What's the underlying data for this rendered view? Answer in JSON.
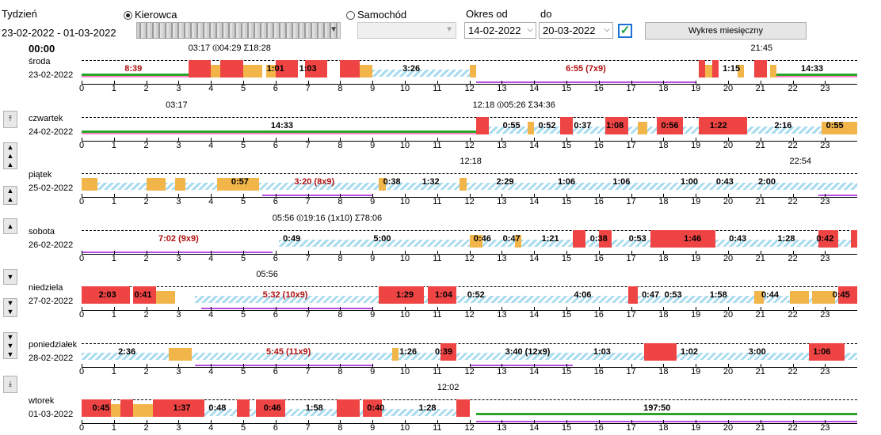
{
  "header": {
    "week_label": "Tydzień",
    "week_range": "23-02-2022 - 01-03-2022",
    "driver_radio": "Kierowca",
    "vehicle_radio": "Samochód",
    "period_from_label": "Okres od",
    "period_to_label": "do",
    "date_from": "14-02-2022",
    "date_to": "20-03-2022",
    "monthly_button": "Wykres miesięczny",
    "start_time": "00:00"
  },
  "colors": {
    "drive": "#ee4444",
    "work": "#f2b54a",
    "rest_hatch": "#a9dcef",
    "green": "#2aa52a",
    "pink": "#ff88cc",
    "purple": "#b44fe0",
    "red_line": "#e33"
  },
  "hours": [
    "0",
    "1",
    "2",
    "3",
    "4",
    "5",
    "6",
    "7",
    "8",
    "9",
    "10",
    "11",
    "12",
    "13",
    "14",
    "15",
    "16",
    "17",
    "18",
    "19",
    "20",
    "21",
    "22",
    "23"
  ],
  "days": [
    {
      "name": "środa",
      "date": "23-02-2022",
      "stats": [
        {
          "text": "03:17 ⏼04:29 Σ18:28",
          "h": 3.3
        },
        {
          "text": "21:45",
          "h": 20.7
        }
      ],
      "labels": [
        {
          "t": "8:39",
          "h": 1.6,
          "red": true
        },
        {
          "t": "1:01",
          "h": 6.0
        },
        {
          "t": "1:03",
          "h": 7.0
        },
        {
          "t": "3:26",
          "h": 10.2
        },
        {
          "t": "6:55 (7x9)",
          "h": 15.6,
          "red": true
        },
        {
          "t": "1:15",
          "h": 20.1
        },
        {
          "t": "14:33",
          "h": 22.6
        }
      ],
      "drive": [
        [
          3.3,
          4.0
        ],
        [
          4.3,
          5.0
        ],
        [
          6.0,
          6.7
        ],
        [
          6.9,
          7.6
        ],
        [
          8.0,
          8.6
        ],
        [
          19.1,
          19.3
        ],
        [
          19.5,
          19.7
        ],
        [
          20.8,
          21.2
        ]
      ],
      "work": [
        [
          4.0,
          4.3
        ],
        [
          5.0,
          5.6
        ],
        [
          5.7,
          6.0
        ],
        [
          8.6,
          9.0
        ],
        [
          12.0,
          12.2
        ],
        [
          19.3,
          19.5
        ],
        [
          20.3,
          20.5
        ],
        [
          21.3,
          21.5
        ]
      ],
      "rest": [
        [
          9.0,
          12.0
        ]
      ],
      "green": [
        [
          0,
          3.3
        ],
        [
          21.5,
          24
        ]
      ],
      "pink": [
        [
          0,
          3.3
        ],
        [
          21.5,
          24
        ]
      ],
      "purple": [
        [
          12.2,
          19.0
        ]
      ]
    },
    {
      "name": "czwartek",
      "date": "24-02-2022",
      "stats": [
        {
          "text": "03:17",
          "h": 2.6
        },
        {
          "text": "12:18 ⏼05:26 Σ34:36",
          "h": 12.1
        }
      ],
      "labels": [
        {
          "t": "14:33",
          "h": 6.2
        },
        {
          "t": "0:55",
          "h": 13.3
        },
        {
          "t": "0:52",
          "h": 14.4
        },
        {
          "t": "0:37",
          "h": 15.5
        },
        {
          "t": "1:08",
          "h": 16.5
        },
        {
          "t": "0:56",
          "h": 18.2
        },
        {
          "t": "1:22",
          "h": 19.7
        },
        {
          "t": "2:16",
          "h": 21.7
        },
        {
          "t": "0:55",
          "h": 23.3
        }
      ],
      "drive": [
        [
          12.2,
          12.6
        ],
        [
          14.8,
          15.2
        ],
        [
          16.2,
          16.9
        ],
        [
          17.8,
          18.6
        ],
        [
          19.1,
          20.6
        ]
      ],
      "work": [
        [
          13.8,
          14.0
        ],
        [
          17.2,
          17.5
        ],
        [
          22.9,
          24
        ]
      ],
      "rest": [
        [
          12.6,
          24
        ]
      ],
      "green": [
        [
          0,
          12.2
        ]
      ],
      "pink": [
        [
          0,
          12.2
        ]
      ],
      "purple": []
    },
    {
      "name": "piątek",
      "date": "25-02-2022",
      "stats": [
        {
          "text": "12:18",
          "h": 11.7
        },
        {
          "text": "22:54",
          "h": 21.9
        }
      ],
      "labels": [
        {
          "t": "0:57",
          "h": 4.9
        },
        {
          "t": "3:20 (8x9)",
          "h": 7.2,
          "red": true
        },
        {
          "t": "0:38",
          "h": 9.6
        },
        {
          "t": "1:32",
          "h": 10.8
        },
        {
          "t": "2:29",
          "h": 13.1
        },
        {
          "t": "1:06",
          "h": 15.0
        },
        {
          "t": "1:06",
          "h": 16.7
        },
        {
          "t": "1:00",
          "h": 18.8
        },
        {
          "t": "0:43",
          "h": 19.9
        },
        {
          "t": "2:00",
          "h": 21.2
        }
      ],
      "drive": [],
      "work": [
        [
          0,
          0.5
        ],
        [
          2.0,
          2.6
        ],
        [
          2.9,
          3.2
        ],
        [
          4.2,
          5.5
        ],
        [
          9.2,
          9.4
        ],
        [
          11.7,
          11.9
        ]
      ],
      "rest": [
        [
          0.5,
          24
        ]
      ],
      "green": [],
      "pink": [],
      "purple": [
        [
          5.6,
          9.0
        ],
        [
          22.8,
          24
        ]
      ]
    },
    {
      "name": "sobota",
      "date": "26-02-2022",
      "stats": [
        {
          "text": "05:56 ⏼19:16 (1x10) Σ78:06",
          "h": 5.9
        }
      ],
      "labels": [
        {
          "t": "7:02 (9x9)",
          "h": 3.0,
          "red": true
        },
        {
          "t": "0:49",
          "h": 6.5
        },
        {
          "t": "5:00",
          "h": 9.3
        },
        {
          "t": "0:46",
          "h": 12.4
        },
        {
          "t": "0:47",
          "h": 13.3
        },
        {
          "t": "1:21",
          "h": 14.5
        },
        {
          "t": "0:38",
          "h": 16.0
        },
        {
          "t": "0:53",
          "h": 17.2
        },
        {
          "t": "1:46",
          "h": 18.9
        },
        {
          "t": "0:43",
          "h": 20.3
        },
        {
          "t": "1:28",
          "h": 21.8
        },
        {
          "t": "0:42",
          "h": 23.0
        }
      ],
      "drive": [
        [
          15.2,
          15.6
        ],
        [
          16.0,
          16.4
        ],
        [
          17.6,
          19.6
        ],
        [
          22.8,
          23.4
        ],
        [
          23.8,
          24
        ]
      ],
      "work": [
        [
          12.0,
          12.4
        ],
        [
          13.4,
          13.6
        ]
      ],
      "rest": [
        [
          6.1,
          24
        ]
      ],
      "green": [],
      "pink": [],
      "purple": [
        [
          0,
          5.9
        ]
      ]
    },
    {
      "name": "niedziela",
      "date": "27-02-2022",
      "stats": [
        {
          "text": "05:56",
          "h": 5.4
        }
      ],
      "labels": [
        {
          "t": "2:03",
          "h": 0.8
        },
        {
          "t": "0:41",
          "h": 1.9
        },
        {
          "t": "5:32 (10x9)",
          "h": 6.3,
          "red": true
        },
        {
          "t": "1:29",
          "h": 10.0
        },
        {
          "t": "1:04",
          "h": 11.2
        },
        {
          "t": "0:52",
          "h": 12.2
        },
        {
          "t": "4:06",
          "h": 15.5
        },
        {
          "t": "0:47",
          "h": 17.6
        },
        {
          "t": "0:53",
          "h": 18.3
        },
        {
          "t": "1:58",
          "h": 19.7
        },
        {
          "t": "0:44",
          "h": 21.3
        },
        {
          "t": "0:45",
          "h": 23.5
        }
      ],
      "drive": [
        [
          0,
          1.5
        ],
        [
          1.6,
          2.3
        ],
        [
          9.2,
          10.6
        ],
        [
          10.7,
          11.6
        ],
        [
          16.9,
          17.2
        ],
        [
          23.4,
          24
        ]
      ],
      "work": [
        [
          2.3,
          2.9
        ],
        [
          20.8,
          21.1
        ],
        [
          21.9,
          22.5
        ],
        [
          22.6,
          23.3
        ]
      ],
      "rest": [
        [
          3.5,
          24
        ]
      ],
      "green": [],
      "pink": [],
      "purple": [
        [
          3.7,
          9.0
        ]
      ]
    },
    {
      "name": "poniedziałek",
      "date": "28-02-2022",
      "stats": [],
      "labels": [
        {
          "t": "2:36",
          "h": 1.4
        },
        {
          "t": "5:45 (11x9)",
          "h": 6.4,
          "red": true
        },
        {
          "t": "1:26",
          "h": 10.1
        },
        {
          "t": "0:39",
          "h": 11.2
        },
        {
          "t": "3:40 (12x9)",
          "h": 13.8
        },
        {
          "t": "1:03",
          "h": 16.1
        },
        {
          "t": "1:02",
          "h": 18.8
        },
        {
          "t": "3:00",
          "h": 20.9
        },
        {
          "t": "1:06",
          "h": 22.9
        }
      ],
      "drive": [
        [
          11.1,
          11.6
        ],
        [
          17.4,
          18.4
        ],
        [
          22.5,
          23.6
        ]
      ],
      "work": [
        [
          2.7,
          3.4
        ],
        [
          9.6,
          9.8
        ]
      ],
      "rest": [
        [
          0,
          24
        ]
      ],
      "green": [],
      "pink": [],
      "purple": [
        [
          3.5,
          9.0
        ],
        [
          12.0,
          15.2
        ]
      ]
    },
    {
      "name": "wtorek",
      "date": "01-03-2022",
      "stats": [
        {
          "text": "12:02",
          "h": 11.0
        }
      ],
      "labels": [
        {
          "t": "0:45",
          "h": 0.6
        },
        {
          "t": "1:37",
          "h": 3.1
        },
        {
          "t": "0:48",
          "h": 4.2
        },
        {
          "t": "0:46",
          "h": 5.9
        },
        {
          "t": "1:58",
          "h": 7.2
        },
        {
          "t": "0:40",
          "h": 9.1
        },
        {
          "t": "1:28",
          "h": 10.7
        },
        {
          "t": "197:50",
          "h": 17.8
        }
      ],
      "drive": [
        [
          0,
          0.9
        ],
        [
          1.2,
          1.6
        ],
        [
          2.2,
          3.8
        ],
        [
          4.8,
          5.2
        ],
        [
          5.4,
          6.3
        ],
        [
          7.9,
          8.6
        ],
        [
          8.7,
          9.3
        ],
        [
          11.6,
          12.0
        ]
      ],
      "work": [
        [
          0.9,
          1.2
        ],
        [
          1.6,
          2.2
        ],
        [
          11.9,
          12.0
        ]
      ],
      "rest": [
        [
          0,
          12.0
        ]
      ],
      "green": [
        [
          12.2,
          24
        ]
      ],
      "pink": [],
      "purple": [
        [
          12.2,
          24
        ]
      ]
    }
  ]
}
